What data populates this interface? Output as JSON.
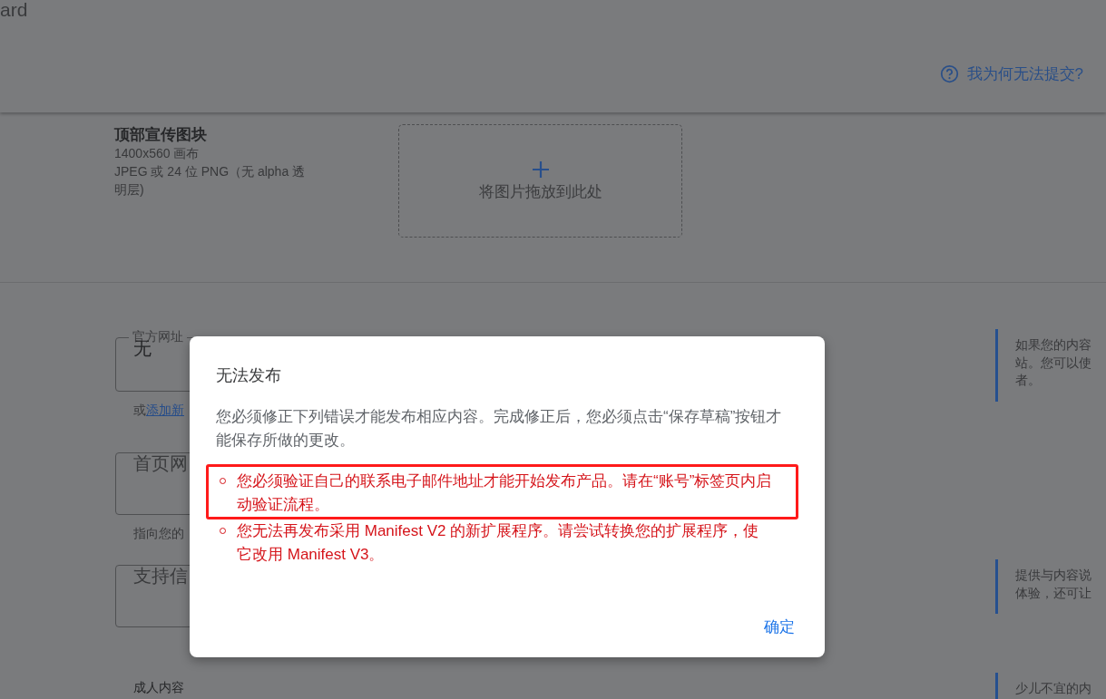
{
  "header": {
    "title_fragment": "ard",
    "help_link": "我为何无法提交?"
  },
  "promo_tile": {
    "title": "顶部宣传图块",
    "details": [
      "1400x560 画布",
      "JPEG 或 24 位 PNG（无 alpha 透明层)"
    ],
    "drop_zone": "将图片拖放到此处"
  },
  "fields": [
    {
      "label": "官方网址",
      "value": "无",
      "helper": [
        {
          "kind": "text",
          "text": "或"
        },
        {
          "kind": "link",
          "text": "添加新"
        }
      ]
    },
    {
      "placeholder": "首页网",
      "helper": [
        {
          "kind": "text",
          "text": "指向您的"
        }
      ]
    },
    {
      "placeholder": "支持信"
    }
  ],
  "adult_content_label": "成人内容",
  "notes": [
    {
      "lines": [
        "如果您的内容",
        "站。您可以使",
        "者。"
      ]
    },
    {
      "lines": [
        "提供与内容说",
        "体验，还可让"
      ]
    },
    {
      "lines": [
        "少儿不宜的内"
      ]
    }
  ],
  "dialog": {
    "title": "无法发布",
    "message": "您必须修正下列错误才能发布相应内容。完成修正后，您必须点击“保存草稿”按钮才能保存所做的更改。",
    "errors": [
      {
        "text": "您必须验证自己的联系电子邮件地址才能开始发布产品。请在“账号”标签页内启动验证流程。",
        "highlighted": true
      },
      {
        "text": "您无法再发布采用 Manifest V2 的新扩展程序。请尝试转换您的扩展程序，使它改用 Manifest V3。",
        "highlighted": false
      }
    ],
    "ok_button": "确定"
  }
}
